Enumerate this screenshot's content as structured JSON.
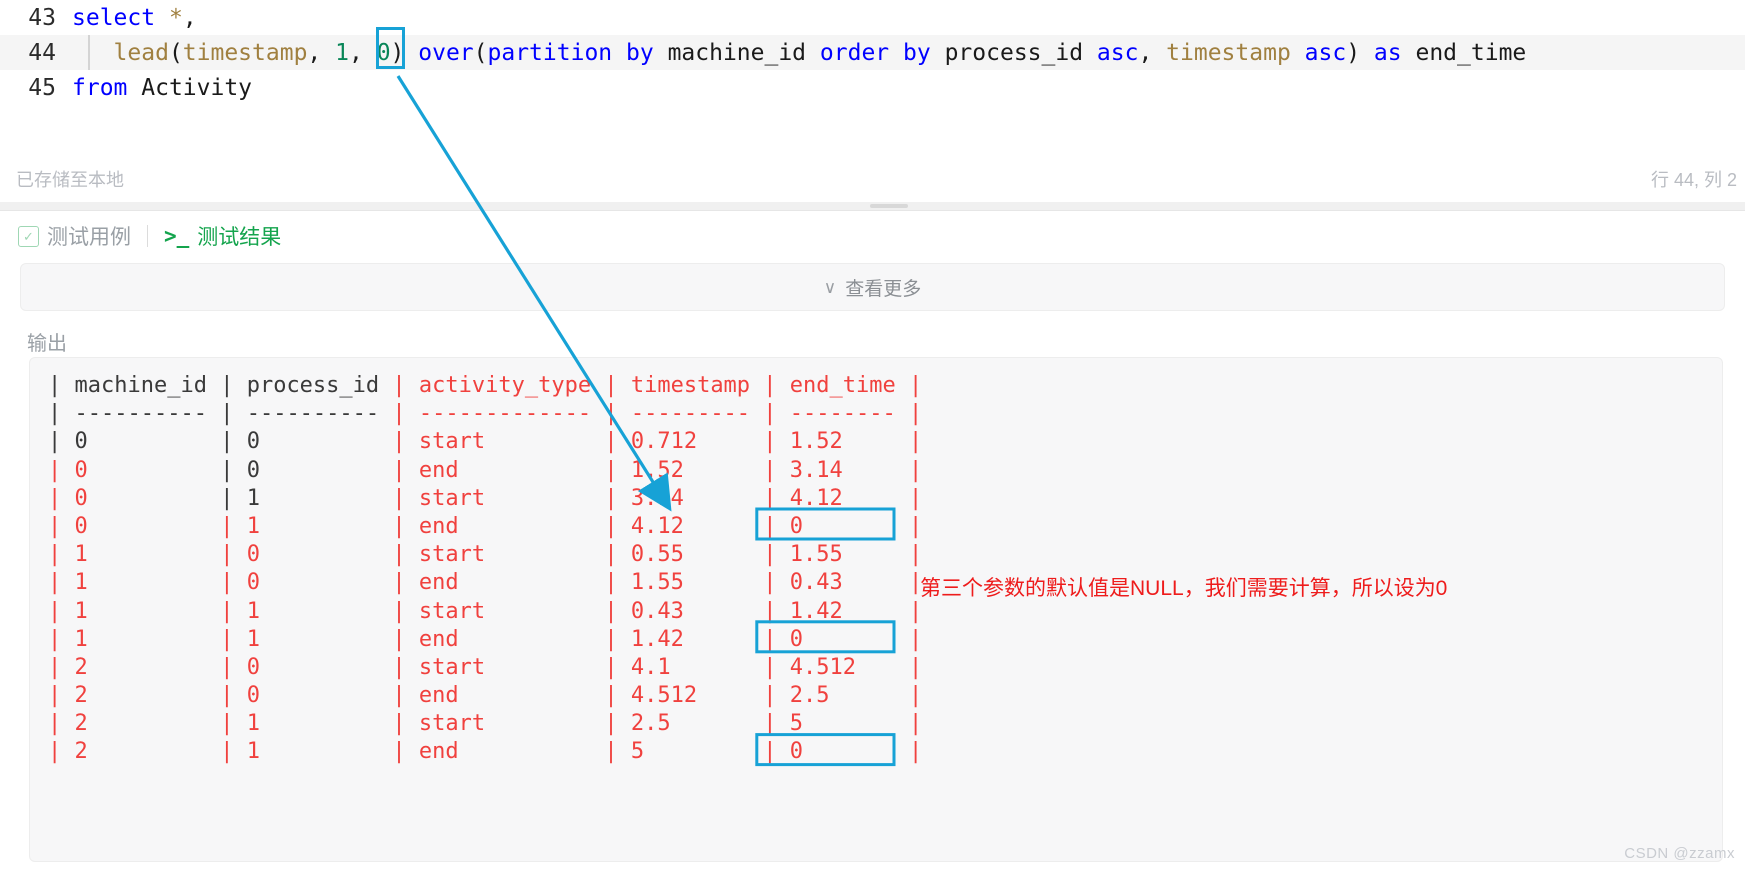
{
  "editor": {
    "lines": [
      {
        "number": "43",
        "active": false,
        "tokens": [
          {
            "t": "select",
            "c": "kw"
          },
          {
            "t": " ",
            "c": "plain"
          },
          {
            "t": "*",
            "c": "fn"
          },
          {
            "t": ",",
            "c": "plain"
          }
        ]
      },
      {
        "number": "44",
        "active": true,
        "tokens": [
          {
            "t": "   ",
            "c": "plain"
          },
          {
            "t": "lead",
            "c": "fn"
          },
          {
            "t": "(",
            "c": "plain"
          },
          {
            "t": "timestamp",
            "c": "fn"
          },
          {
            "t": ", ",
            "c": "plain"
          },
          {
            "t": "1",
            "c": "num"
          },
          {
            "t": ", ",
            "c": "plain"
          },
          {
            "t": "0",
            "c": "num"
          },
          {
            "t": ")",
            "c": "plain"
          },
          {
            "t": " ",
            "c": "plain"
          },
          {
            "t": "over",
            "c": "kw"
          },
          {
            "t": "(",
            "c": "plain"
          },
          {
            "t": "partition",
            "c": "kw"
          },
          {
            "t": " ",
            "c": "plain"
          },
          {
            "t": "by",
            "c": "kw"
          },
          {
            "t": " ",
            "c": "plain"
          },
          {
            "t": "machine_id",
            "c": "plain"
          },
          {
            "t": " ",
            "c": "plain"
          },
          {
            "t": "order",
            "c": "kw"
          },
          {
            "t": " ",
            "c": "plain"
          },
          {
            "t": "by",
            "c": "kw"
          },
          {
            "t": " ",
            "c": "plain"
          },
          {
            "t": "process_id",
            "c": "plain"
          },
          {
            "t": " ",
            "c": "plain"
          },
          {
            "t": "asc",
            "c": "kw"
          },
          {
            "t": ", ",
            "c": "plain"
          },
          {
            "t": "timestamp",
            "c": "fn"
          },
          {
            "t": " ",
            "c": "plain"
          },
          {
            "t": "asc",
            "c": "kw"
          },
          {
            "t": ")",
            "c": "plain"
          },
          {
            "t": " ",
            "c": "plain"
          },
          {
            "t": "as",
            "c": "kw"
          },
          {
            "t": " ",
            "c": "plain"
          },
          {
            "t": "end_time",
            "c": "plain"
          }
        ]
      },
      {
        "number": "45",
        "active": false,
        "tokens": [
          {
            "t": "from",
            "c": "kw"
          },
          {
            "t": " ",
            "c": "plain"
          },
          {
            "t": "Activity",
            "c": "plain"
          }
        ]
      }
    ]
  },
  "status": {
    "saved_text": "已存储至本地",
    "caret": "行 44, 列 2"
  },
  "tabs": [
    {
      "label": "测试用例",
      "icon": "checkbox-icon",
      "active": false
    },
    {
      "label": "测试结果",
      "icon": "terminal-prompt-icon",
      "active": true
    }
  ],
  "collapsed": {
    "label": "查看更多",
    "icon": "double-chevron-down-icon"
  },
  "output": {
    "label": "输出",
    "columns": [
      "machine_id",
      "process_id",
      "activity_type",
      "timestamp",
      "end_time"
    ],
    "separators": [
      "----------",
      "----------",
      "-------------",
      "---------",
      "--------"
    ],
    "column_colors": [
      "dark",
      "dark",
      "red",
      "red",
      "red"
    ],
    "separator_colors": [
      "dark",
      "dark",
      "red",
      "red",
      "red"
    ],
    "rows": [
      {
        "cells": [
          "0",
          "0",
          "start",
          "0.712",
          "1.52"
        ],
        "colors": [
          "dark",
          "dark",
          "red",
          "red",
          "red"
        ],
        "highlight": false
      },
      {
        "cells": [
          "0",
          "0",
          "end",
          "1.52",
          "3.14"
        ],
        "colors": [
          "red",
          "dark",
          "red",
          "red",
          "red"
        ],
        "highlight": false
      },
      {
        "cells": [
          "0",
          "1",
          "start",
          "3.14",
          "4.12"
        ],
        "colors": [
          "red",
          "dark",
          "red",
          "red",
          "red"
        ],
        "highlight": false
      },
      {
        "cells": [
          "0",
          "1",
          "end",
          "4.12",
          "0"
        ],
        "colors": [
          "red",
          "red",
          "red",
          "red",
          "red"
        ],
        "highlight": true
      },
      {
        "cells": [
          "1",
          "0",
          "start",
          "0.55",
          "1.55"
        ],
        "colors": [
          "red",
          "red",
          "red",
          "red",
          "red"
        ],
        "highlight": false
      },
      {
        "cells": [
          "1",
          "0",
          "end",
          "1.55",
          "0.43"
        ],
        "colors": [
          "red",
          "red",
          "red",
          "red",
          "red"
        ],
        "highlight": false
      },
      {
        "cells": [
          "1",
          "1",
          "start",
          "0.43",
          "1.42"
        ],
        "colors": [
          "red",
          "red",
          "red",
          "red",
          "red"
        ],
        "highlight": false
      },
      {
        "cells": [
          "1",
          "1",
          "end",
          "1.42",
          "0"
        ],
        "colors": [
          "red",
          "red",
          "red",
          "red",
          "red"
        ],
        "highlight": true
      },
      {
        "cells": [
          "2",
          "0",
          "start",
          "4.1",
          "4.512"
        ],
        "colors": [
          "red",
          "red",
          "red",
          "red",
          "red"
        ],
        "highlight": false
      },
      {
        "cells": [
          "2",
          "0",
          "end",
          "4.512",
          "2.5"
        ],
        "colors": [
          "red",
          "red",
          "red",
          "red",
          "red"
        ],
        "highlight": false
      },
      {
        "cells": [
          "2",
          "1",
          "start",
          "2.5",
          "5"
        ],
        "colors": [
          "red",
          "red",
          "red",
          "red",
          "red"
        ],
        "highlight": false
      },
      {
        "cells": [
          "2",
          "1",
          "end",
          "5",
          "0"
        ],
        "colors": [
          "red",
          "red",
          "red",
          "red",
          "red"
        ],
        "highlight": true
      }
    ]
  },
  "annotation": {
    "text": "第三个参数的默认值是NULL，我们需要计算，所以设为0",
    "color": "#ee1c1c",
    "arrow_color": "#17a2d6"
  },
  "watermark": "CSDN @zzamx",
  "colors": {
    "highlight_box": "#17a2d6",
    "table_red": "#f0413e",
    "table_dark": "#3a3a3a",
    "tab_active": "#14a44d",
    "tab_inactive": "#9aa0a6"
  }
}
